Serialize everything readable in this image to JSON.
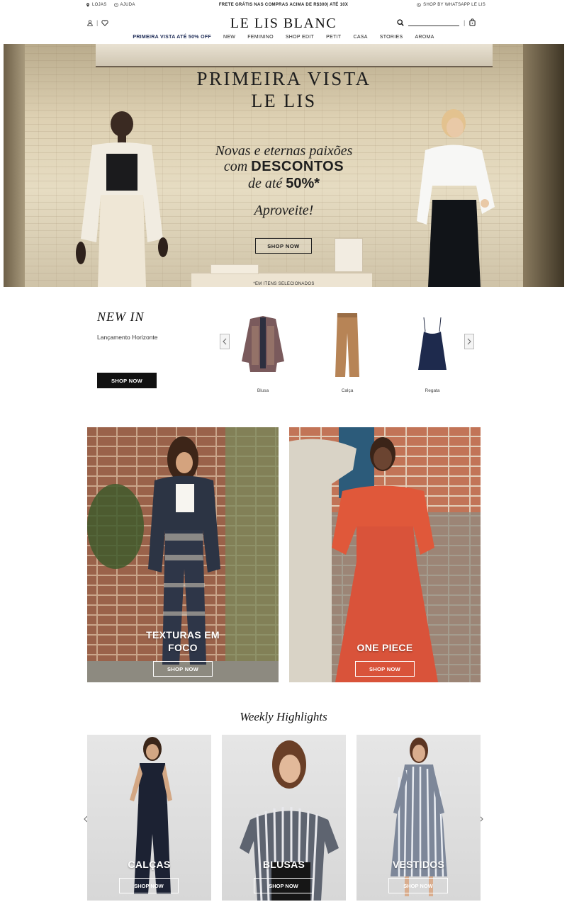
{
  "topbar": {
    "stores": "LOJAS",
    "help": "AJUDA",
    "promo": "FRETE GRÁTIS NAS COMPRAS ACIMA DE R$300| ATÉ 10X",
    "whatsapp": "SHOP BY WHATSAPP LE LIS"
  },
  "header": {
    "logo": "LE LIS BLANC",
    "separator": "|"
  },
  "nav": {
    "items": [
      "PRIMEIRA VISTA ATÉ 50% OFF",
      "NEW",
      "FEMININO",
      "SHOP EDIT",
      "PETIT",
      "CASA",
      "STORIES",
      "AROMA"
    ]
  },
  "hero": {
    "title_line1": "PRIMEIRA VISTA",
    "title_line2": "LE LIS",
    "line1": "Novas e eternas  paixões",
    "line2_prefix": "com ",
    "line2_bold": "DESCONTOS",
    "line3_prefix": "de até ",
    "line3_bold": "50%*",
    "line4": "Aproveite!",
    "button": "SHOP NOW",
    "note": "*EM ITENS SELECIONADOS"
  },
  "new_in": {
    "title": "NEW IN",
    "subtitle": "Lançamento Horizonte",
    "button": "SHOP NOW",
    "products": [
      {
        "label": "Blusa"
      },
      {
        "label": "Calça"
      },
      {
        "label": "Regata"
      }
    ]
  },
  "campaigns": [
    {
      "title_line1": "TEXTURAS EM",
      "title_line2": "FOCO",
      "button": "SHOP NOW"
    },
    {
      "title_line1": "ONE PIECE",
      "title_line2": "",
      "button": "SHOP NOW"
    }
  ],
  "weekly": {
    "title": "Weekly Highlights",
    "cards": [
      {
        "title": "CALÇAS",
        "button": "SHOP NOW"
      },
      {
        "title": "BLUSAS",
        "button": "SHOP NOW"
      },
      {
        "title": "VESTIDOS",
        "button": "SHOP NOW"
      }
    ]
  },
  "colors": {
    "accent_nav": "#1c2a55",
    "button_dark": "#111111"
  }
}
